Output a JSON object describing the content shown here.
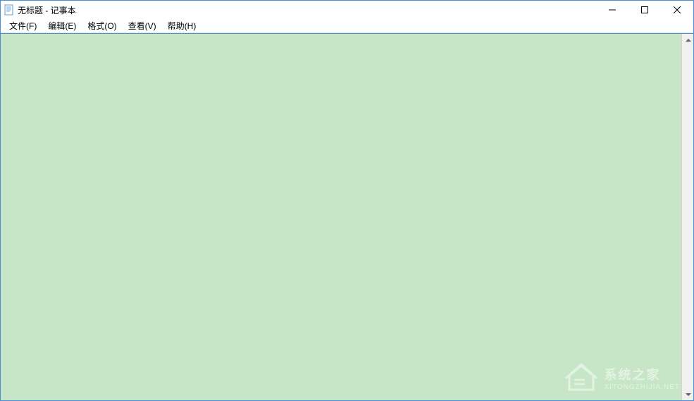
{
  "titlebar": {
    "title": "无标题 - 记事本"
  },
  "menubar": {
    "items": [
      {
        "label": "文件(F)"
      },
      {
        "label": "编辑(E)"
      },
      {
        "label": "格式(O)"
      },
      {
        "label": "查看(V)"
      },
      {
        "label": "帮助(H)"
      }
    ]
  },
  "editor": {
    "content": "",
    "background_color": "#c7e6c7"
  },
  "watermark": {
    "text_main": "系统之家",
    "text_sub": "XITONGZHIJIA.NET"
  }
}
